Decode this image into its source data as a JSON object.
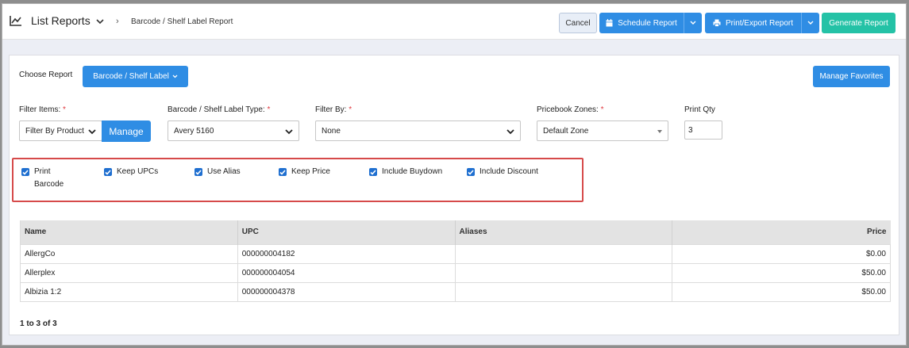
{
  "header": {
    "title": "List Reports",
    "breadcrumb_sep": "›",
    "breadcrumb": "Barcode / Shelf Label Report"
  },
  "toolbar": {
    "cancel_label": "Cancel",
    "schedule_label": "Schedule Report",
    "print_label": "Print/Export Report",
    "generate_label": "Generate Report"
  },
  "report": {
    "choose_label": "Choose Report",
    "selected": "Barcode / Shelf Label",
    "favorites_label": "Manage Favorites"
  },
  "filters": {
    "filter_items_label": "Filter Items:",
    "filter_items_value": "Filter By Product",
    "manage_label": "Manage",
    "label_type_label": "Barcode / Shelf Label Type:",
    "label_type_value": "Avery 5160",
    "filter_by_label": "Filter By:",
    "filter_by_value": "None",
    "zones_label": "Pricebook Zones:",
    "zones_value": "Default Zone",
    "print_qty_label": "Print Qty",
    "print_qty_value": "3",
    "required_mark": "*"
  },
  "options": [
    {
      "line1": "Print",
      "line2": "Barcode",
      "checked": true
    },
    {
      "line1": "Keep UPCs",
      "line2": "",
      "checked": true
    },
    {
      "line1": "Use Alias",
      "line2": "",
      "checked": true
    },
    {
      "line1": "Keep Price",
      "line2": "",
      "checked": true
    },
    {
      "line1": "Include Buydown",
      "line2": "",
      "checked": true
    },
    {
      "line1": "Include Discount",
      "line2": "",
      "checked": true
    }
  ],
  "table": {
    "headers": [
      "Name",
      "UPC",
      "Aliases",
      "Price"
    ],
    "rows": [
      [
        "AllergCo",
        "000000004182",
        "",
        "$0.00"
      ],
      [
        "Allerplex",
        "000000004054",
        "",
        "$50.00"
      ],
      [
        "Albizia 1:2",
        "000000004378",
        "",
        "$50.00"
      ]
    ]
  },
  "pager": "1 to 3 of 3",
  "colors": {
    "primary": "#2f8de4",
    "teal": "#24c2a6",
    "checkbox": "#1f6fd0",
    "highlight": "#d64a4a"
  }
}
